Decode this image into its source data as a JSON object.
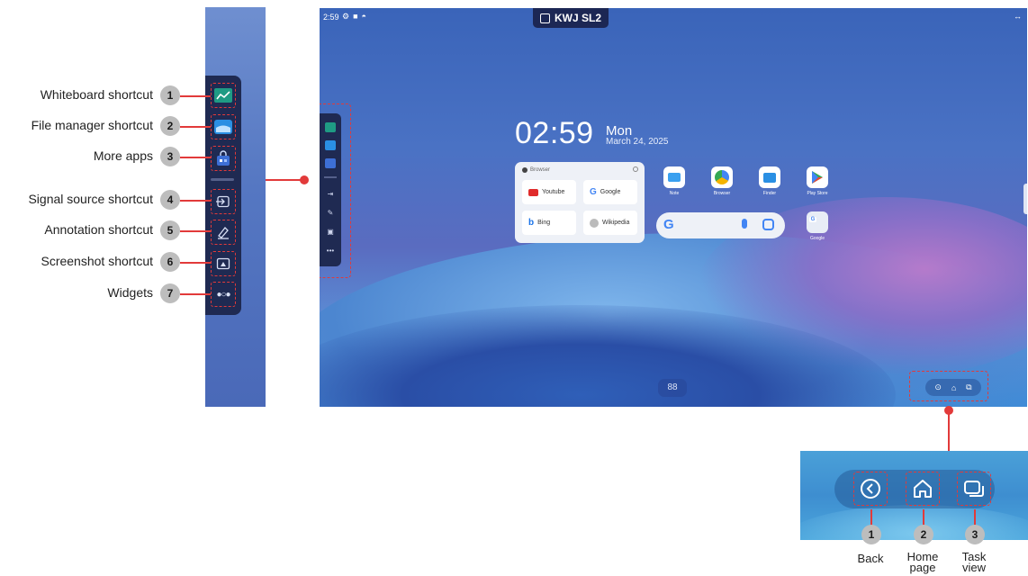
{
  "sidebar_callouts": [
    {
      "num": "1",
      "label": "Whiteboard shortcut"
    },
    {
      "num": "2",
      "label": "File manager shortcut"
    },
    {
      "num": "3",
      "label": "More apps"
    },
    {
      "num": "4",
      "label": "Signal source shortcut"
    },
    {
      "num": "5",
      "label": "Annotation shortcut"
    },
    {
      "num": "6",
      "label": "Screenshot shortcut"
    },
    {
      "num": "7",
      "label": "Widgets"
    }
  ],
  "screen": {
    "status_time": "2:59",
    "device_title": "KWJ SL2",
    "clock": "02:59",
    "day": "Mon",
    "date": "March 24, 2025",
    "browser_widget": {
      "header": "Browser",
      "bookmarks": [
        "Youtube",
        "Google",
        "Bing",
        "Wikipedia"
      ]
    },
    "apps": [
      "Note",
      "Browser",
      "Finder",
      "Play Store"
    ],
    "google_folder_label": "Google",
    "apps_button_glyph": "88"
  },
  "nav_callouts": [
    {
      "num": "1",
      "label": "Back"
    },
    {
      "num": "2",
      "label": "Home page"
    },
    {
      "num": "3",
      "label": "Task view"
    }
  ],
  "colors": {
    "accent_red": "#e23a3a",
    "toolbar_navy": "#1f2a52",
    "badge_gray": "#bdbdbd"
  }
}
